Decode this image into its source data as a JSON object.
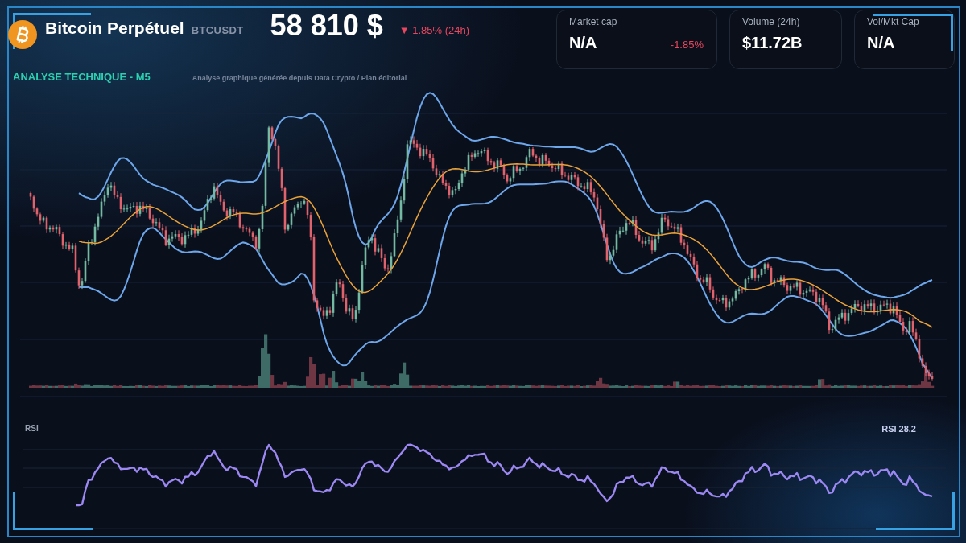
{
  "header": {
    "title": "Bitcoin Perpétuel",
    "ticker": "BTCUSDT",
    "price": "58 810 $",
    "change": "▼ 1.85% (24h)"
  },
  "stats": [
    {
      "label": "Market cap",
      "value": "N/A",
      "change": "-1.85%"
    },
    {
      "label": "Volume (24h)",
      "value": "$11.72B"
    },
    {
      "label": "Vol/Mkt Cap",
      "value": "N/A"
    }
  ],
  "analysis": {
    "title": "ANALYSE TECHNIQUE - M5",
    "caption": "Analyse graphique générée depuis Data Crypto / Plan éditorial"
  },
  "rsi": {
    "label": "RSI",
    "reading": "RSI 28.2"
  }
}
